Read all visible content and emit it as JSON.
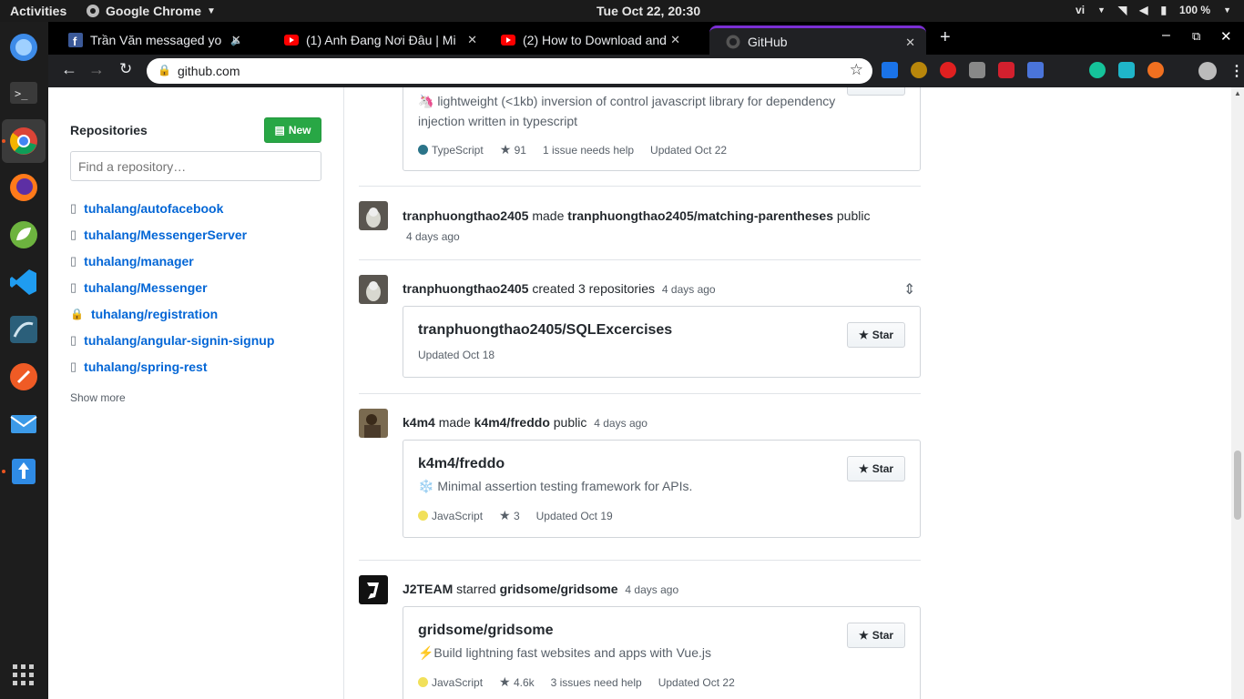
{
  "system": {
    "activities": "Activities",
    "app_name": "Google Chrome",
    "clock": "Tue Oct 22, 20:30",
    "lang": "vi",
    "battery": "100 %"
  },
  "tabs": [
    {
      "title": "Trần Văn messaged yo",
      "icon": "facebook-icon"
    },
    {
      "title": "(1) Anh Đang Nơi Đâu | Mi",
      "icon": "youtube-icon"
    },
    {
      "title": "(2) How to Download and",
      "icon": "youtube-icon"
    },
    {
      "title": "GitHub",
      "icon": "github-icon"
    }
  ],
  "omnibox": {
    "url": "github.com"
  },
  "sidebar": {
    "title": "Repositories",
    "new_label": "New",
    "find_placeholder": "Find a repository…",
    "repos": [
      {
        "name": "tuhalang/autofacebook",
        "private": false
      },
      {
        "name": "tuhalang/MessengerServer",
        "private": false
      },
      {
        "name": "tuhalang/manager",
        "private": false
      },
      {
        "name": "tuhalang/Messenger",
        "private": false
      },
      {
        "name": "tuhalang/registration",
        "private": true
      },
      {
        "name": "tuhalang/angular-signin-signup",
        "private": false
      },
      {
        "name": "tuhalang/spring-rest",
        "private": false
      }
    ],
    "show_more": "Show more"
  },
  "feed": {
    "card0": {
      "desc_line1": "🦄 lightweight (<1kb) inversion of control javascript library for dependency",
      "desc_line2": "injection written in typescript",
      "language": "TypeScript",
      "lang_color": "#2b7489",
      "stars": "91",
      "issues": "1 issue needs help",
      "updated": "Updated Oct 22"
    },
    "event1": {
      "actor": "tranphuongthao2405",
      "verb": "made",
      "target": "tranphuongthao2405/matching-parentheses",
      "tail": "public",
      "ago": "4 days ago"
    },
    "event2": {
      "actor": "tranphuongthao2405",
      "verb": "created 3 repositories",
      "ago": "4 days ago",
      "repo_name": "tranphuongthao2405/SQLExcercises",
      "updated": "Updated Oct 18",
      "star_label": "Star"
    },
    "event3": {
      "actor": "k4m4",
      "verb": "made",
      "target": "k4m4/freddo",
      "tail": "public",
      "ago": "4 days ago",
      "repo_name": "k4m4/freddo",
      "desc": "❄️ Minimal assertion testing framework for APIs.",
      "language": "JavaScript",
      "lang_color": "#f1e05a",
      "stars": "3",
      "updated": "Updated Oct 19",
      "star_label": "Star"
    },
    "event4": {
      "actor": "J2TEAM",
      "verb": "starred",
      "target": "gridsome/gridsome",
      "ago": "4 days ago",
      "repo_name": "gridsome/gridsome",
      "desc": "⚡Build lightning fast websites and apps with Vue.js",
      "language": "JavaScript",
      "lang_color": "#f1e05a",
      "stars": "4.6k",
      "issues": "3 issues need help",
      "updated": "Updated Oct 22",
      "star_label": "Star"
    }
  }
}
